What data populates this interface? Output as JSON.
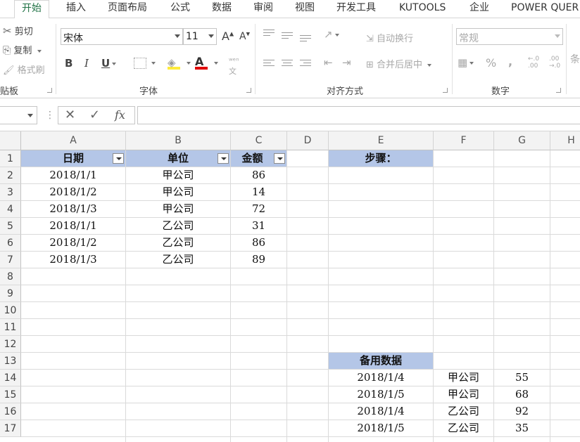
{
  "ribbon_tabs": [
    {
      "label": "开始",
      "active": true
    },
    {
      "label": "插入"
    },
    {
      "label": "页面布局"
    },
    {
      "label": "公式"
    },
    {
      "label": "数据"
    },
    {
      "label": "审阅"
    },
    {
      "label": "视图"
    },
    {
      "label": "开发工具"
    },
    {
      "label": "KUTOOLS"
    },
    {
      "label": "企业"
    },
    {
      "label": "POWER QUER"
    }
  ],
  "clipboard": {
    "cut": "剪切",
    "copy": "复制",
    "format_painter": "格式刷",
    "group_label": "贴板"
  },
  "font": {
    "font_name": "宋体",
    "font_size": "11",
    "grow": "A",
    "shrink": "A",
    "bold": "B",
    "italic": "I",
    "underline": "U",
    "font_color_glyph": "A",
    "group_label": "字体"
  },
  "alignment": {
    "wrap_text": "自动换行",
    "merge_center": "合并后居中",
    "group_label": "对齐方式"
  },
  "number": {
    "format": "常规",
    "percent": "%",
    "comma": ",",
    "group_label": "数字",
    "cut_off_label": "条"
  },
  "formula_bar": {
    "fx": "fx",
    "name_box": "",
    "formula": ""
  },
  "columns": [
    "A",
    "B",
    "C",
    "D",
    "E",
    "F",
    "G",
    "H"
  ],
  "rows": [
    "1",
    "2",
    "3",
    "4",
    "5",
    "6",
    "7",
    "8",
    "9",
    "10",
    "11",
    "12",
    "13",
    "14",
    "15",
    "16",
    "17"
  ],
  "table": {
    "headers": [
      "日期",
      "单位",
      "金额"
    ],
    "rows": [
      [
        "2018/1/1",
        "甲公司",
        "86"
      ],
      [
        "2018/1/2",
        "甲公司",
        "14"
      ],
      [
        "2018/1/3",
        "甲公司",
        "72"
      ],
      [
        "2018/1/1",
        "乙公司",
        "31"
      ],
      [
        "2018/1/2",
        "乙公司",
        "86"
      ],
      [
        "2018/1/3",
        "乙公司",
        "89"
      ]
    ]
  },
  "steps_label": "步骤：",
  "backup": {
    "title": "备用数据",
    "rows": [
      [
        "2018/1/4",
        "甲公司",
        "55"
      ],
      [
        "2018/1/5",
        "甲公司",
        "68"
      ],
      [
        "2018/1/4",
        "乙公司",
        "92"
      ],
      [
        "2018/1/5",
        "乙公司",
        "35"
      ]
    ]
  },
  "colors": {
    "header_fill": "#b4c6e7",
    "accent": "#217346"
  }
}
